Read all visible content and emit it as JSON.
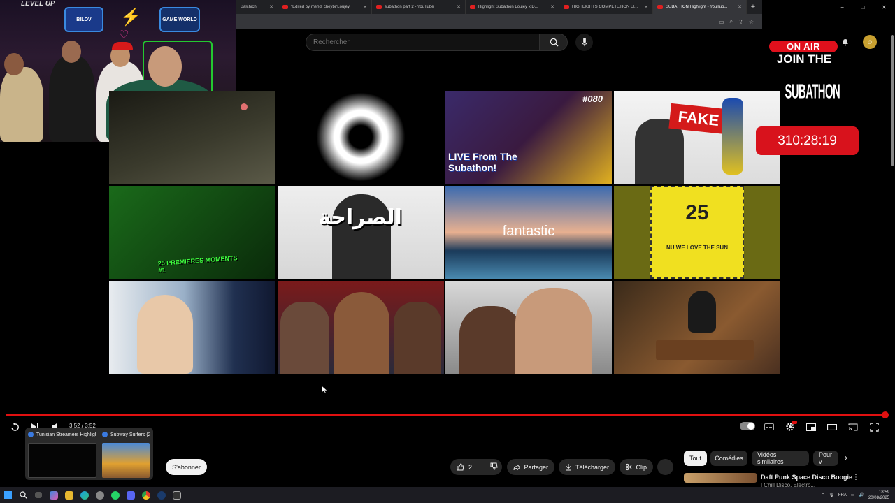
{
  "browser": {
    "tabs": [
      {
        "title": "Balchich"
      },
      {
        "title": "\"Edited by mehdi cheybi\"Loujey"
      },
      {
        "title": "subathon part 2 - YouTube"
      },
      {
        "title": "Highlight Subathon Loujey x D..."
      },
      {
        "title": "HIGHLIGHTS COMPETETION LI..."
      },
      {
        "title": "SUBATHON Highlight - YouTub..."
      }
    ],
    "new_tab_label": "+",
    "window_controls": [
      "−",
      "□",
      "✕"
    ]
  },
  "youtube": {
    "search_placeholder": "Rechercher",
    "thumbnails": [
      {
        "label": ""
      },
      {
        "label": ""
      },
      {
        "label": "LIVE From The Subathon!",
        "badge": "#080"
      },
      {
        "label": "FAKE"
      },
      {
        "label": "25 PREMIERES MOMENTS #1"
      },
      {
        "label": "الصراحة"
      },
      {
        "label": "fantastic"
      },
      {
        "label": "25",
        "sublabel": "NU WE LOVE THE SUN"
      },
      {
        "label": ""
      },
      {
        "label": ""
      },
      {
        "label": ""
      },
      {
        "label": ""
      }
    ],
    "player": {
      "time": "3:52 / 3:52",
      "progress_fraction": 1.0
    },
    "actions": {
      "subscribe": "S'abonner",
      "likes": "2",
      "share": "Partager",
      "download": "Télécharger",
      "clip": "Clip",
      "more": "⋯"
    },
    "chips": [
      {
        "label": "Tout",
        "active": true
      },
      {
        "label": "Comédies",
        "active": false
      },
      {
        "label": "Vidéos similaires",
        "active": false
      },
      {
        "label": "Pour v",
        "active": false
      }
    ],
    "recommendation": {
      "title": "Daft Punk Space Disco Boogie",
      "subtitle": "| Chill Disco, Electro..."
    }
  },
  "overlay": {
    "on_air": "ON AIR",
    "join_the": "JOIN THE",
    "subathon": "SUBATHON",
    "timer": "310:28:19"
  },
  "webcam": {
    "sign_left": "BILOV",
    "sign_right": "GAME WORLD",
    "level_up": "LEVEL UP"
  },
  "taskbar_previews": [
    {
      "title": "Tunisian Streamers Highligh..."
    },
    {
      "title": "Subway Surfers (2..."
    }
  ],
  "system_tray": {
    "language": "FRA",
    "time": "18:59",
    "date": "20/08/2025"
  },
  "colors": {
    "accent_red": "#e01010",
    "youtube_bg": "#0f0f0f",
    "chip_bg": "#272727"
  }
}
